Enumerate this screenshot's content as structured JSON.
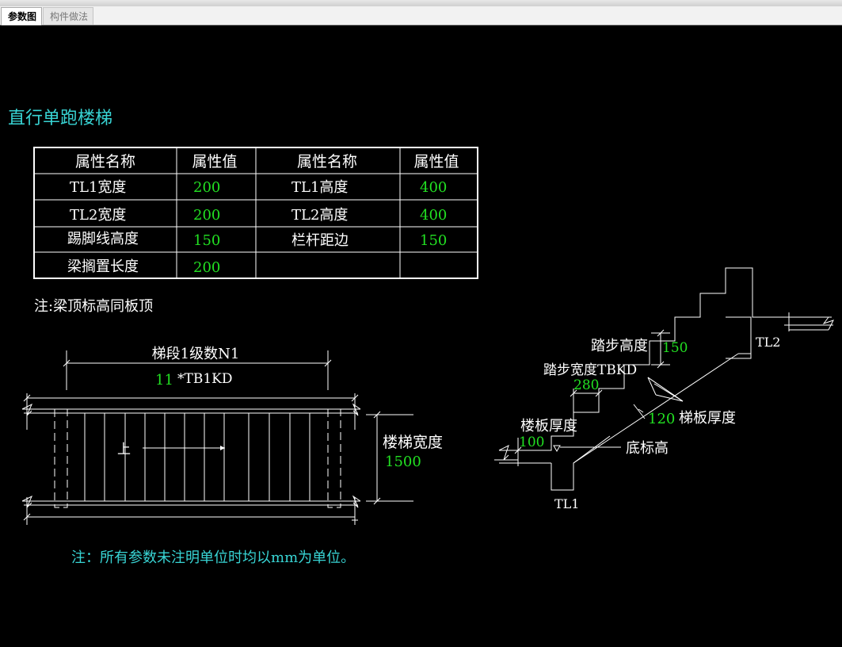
{
  "tabs": {
    "active": "参数图",
    "inactive": "构件做法"
  },
  "title": "直行单跑楼梯",
  "table": {
    "headers": [
      "属性名称",
      "属性值",
      "属性名称",
      "属性值"
    ],
    "rows": [
      [
        "TL1宽度",
        "200",
        "TL1高度",
        "400"
      ],
      [
        "TL2宽度",
        "200",
        "TL2高度",
        "400"
      ],
      [
        "踢脚线高度",
        "150",
        "栏杆距边",
        "150"
      ],
      [
        "梁搁置长度",
        "200",
        "",
        ""
      ]
    ]
  },
  "note_top": "注:梁顶标高同板顶",
  "plan": {
    "n1_label": "梯段1级数N1",
    "steps_count": "11",
    "tb1kd": "*TB1KD",
    "up_label": "上",
    "width_label": "楼梯宽度",
    "width_value": "1500"
  },
  "section": {
    "step_height_label": "踏步高度",
    "step_height_value": "150",
    "step_width_label": "踏步宽度TBKD",
    "step_width_value": "280",
    "slab_label": "楼板厚度",
    "slab_value": "100",
    "stair_slab_value": "120",
    "stair_slab_label": "梯板厚度",
    "bottom_elev_label": "底标高",
    "tl1_label": "TL1",
    "tl2_label": "TL2"
  },
  "note_bottom": "注：所有参数未注明单位时均以mm为单位。",
  "colors": {
    "background": "#000000",
    "title": "#38d4d4",
    "value": "#22e022",
    "line": "#ffffff"
  }
}
